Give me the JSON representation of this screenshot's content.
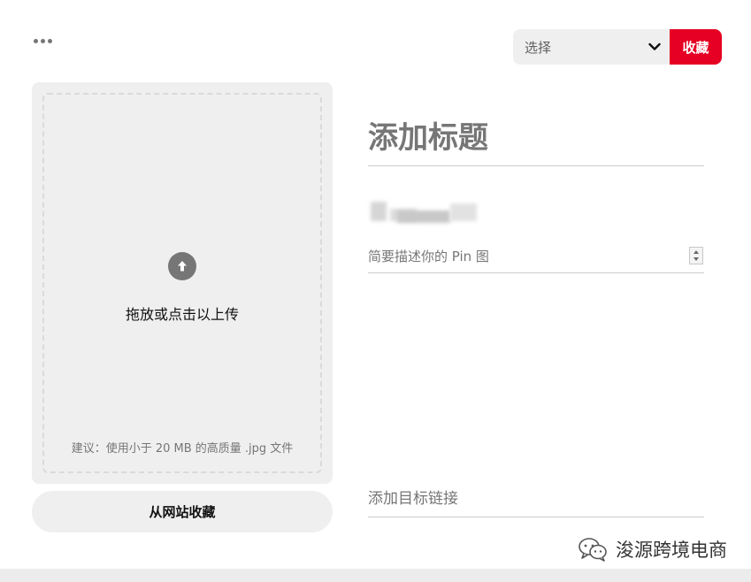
{
  "header": {
    "board_select": {
      "placeholder": "选择"
    },
    "save_label": "收藏"
  },
  "upload": {
    "instruction": "拖放或点击以上传",
    "hint": "建议：使用小于 20 MB 的高质量 .jpg 文件",
    "from_website_label": "从网站收藏"
  },
  "form": {
    "title_placeholder": "添加标题",
    "description_placeholder": "简要描述你的 Pin 图",
    "link_placeholder": "添加目标链接"
  },
  "watermark": {
    "text": "浚源跨境电商"
  },
  "colors": {
    "accent": "#e60023",
    "surface": "#efefef"
  }
}
